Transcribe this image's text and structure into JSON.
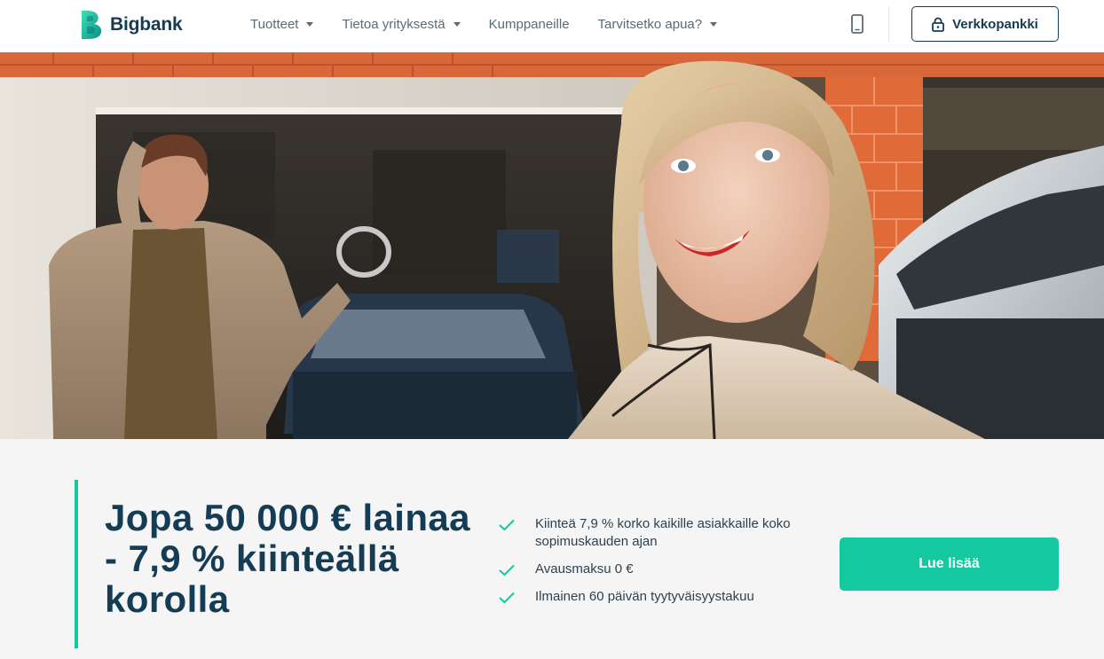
{
  "header": {
    "logo_text": "Bigbank",
    "nav": [
      {
        "label": "Tuotteet",
        "dropdown": true
      },
      {
        "label": "Tietoa yrityksestä",
        "dropdown": true
      },
      {
        "label": "Kumppaneille",
        "dropdown": false
      },
      {
        "label": "Tarvitsetko apua?",
        "dropdown": true
      }
    ],
    "phone_icon": "mobile-phone-icon",
    "bank_button": {
      "label": "Verkkopankki",
      "icon": "lock-icon"
    }
  },
  "hero": {
    "image": "photo-woman-smiling-by-car-man-in-garage"
  },
  "promo": {
    "headline": "Jopa 50 000 € lainaa - 7,9 % kiinteällä korolla",
    "features": [
      "Kiinteä 7,9 % korko kaikille asiakkaille koko sopimuskauden ajan",
      "Avausmaksu 0 €",
      "Ilmainen 60 päivän tyytyväisyystakuu"
    ],
    "cta_label": "Lue lisää"
  },
  "colors": {
    "brand_navy": "#143c55",
    "brand_green": "#14c8a0",
    "nav_text": "#5b6b76",
    "background": "#f5f5f6"
  }
}
